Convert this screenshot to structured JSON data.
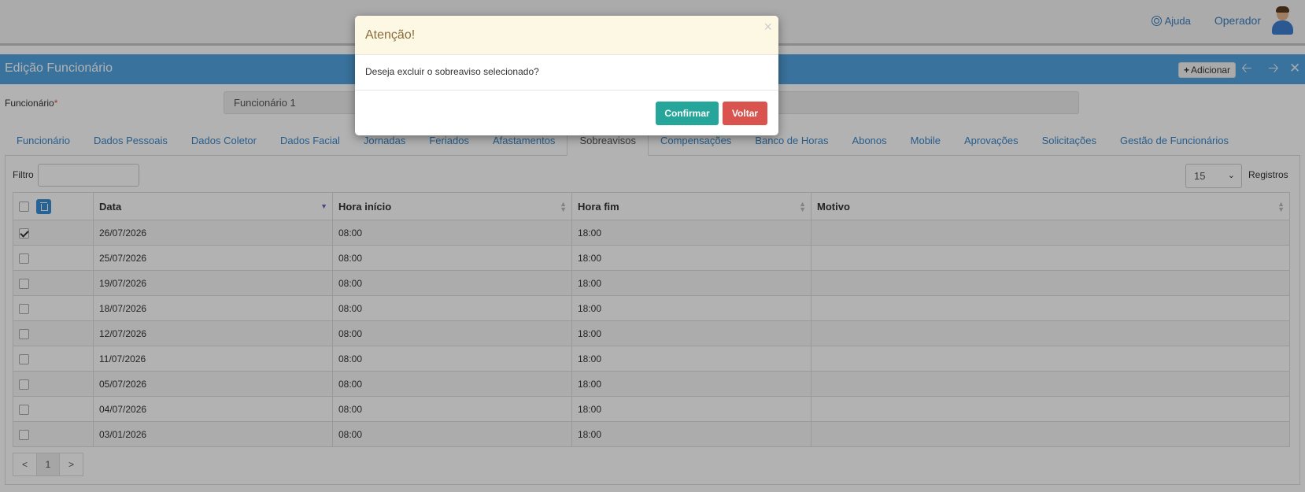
{
  "header": {
    "help_label": "Ajuda",
    "user_label": "Operador"
  },
  "titlebar": {
    "title": "Edição Funcionário",
    "add_label": "Adicionar"
  },
  "employee": {
    "label": "Funcionário",
    "required_mark": "*",
    "value": "Funcionário 1"
  },
  "tabs": [
    {
      "label": "Funcionário"
    },
    {
      "label": "Dados Pessoais"
    },
    {
      "label": "Dados Coletor"
    },
    {
      "label": "Dados Facial"
    },
    {
      "label": "Jornadas"
    },
    {
      "label": "Feriados"
    },
    {
      "label": "Afastamentos"
    },
    {
      "label": "Sobreavisos",
      "active": true
    },
    {
      "label": "Compensações"
    },
    {
      "label": "Banco de Horas"
    },
    {
      "label": "Abonos"
    },
    {
      "label": "Mobile"
    },
    {
      "label": "Aprovações"
    },
    {
      "label": "Solicitações"
    },
    {
      "label": "Gestão de Funcionários"
    }
  ],
  "filter": {
    "label": "Filtro",
    "value": ""
  },
  "page_size": {
    "value": "15",
    "records_label": "Registros"
  },
  "table": {
    "columns": [
      "Data",
      "Hora início",
      "Hora fim",
      "Motivo"
    ],
    "rows": [
      {
        "checked": true,
        "data": "26/07/2026",
        "inicio": "08:00",
        "fim": "18:00",
        "motivo": ""
      },
      {
        "checked": false,
        "data": "25/07/2026",
        "inicio": "08:00",
        "fim": "18:00",
        "motivo": ""
      },
      {
        "checked": false,
        "data": "19/07/2026",
        "inicio": "08:00",
        "fim": "18:00",
        "motivo": ""
      },
      {
        "checked": false,
        "data": "18/07/2026",
        "inicio": "08:00",
        "fim": "18:00",
        "motivo": ""
      },
      {
        "checked": false,
        "data": "12/07/2026",
        "inicio": "08:00",
        "fim": "18:00",
        "motivo": ""
      },
      {
        "checked": false,
        "data": "11/07/2026",
        "inicio": "08:00",
        "fim": "18:00",
        "motivo": ""
      },
      {
        "checked": false,
        "data": "05/07/2026",
        "inicio": "08:00",
        "fim": "18:00",
        "motivo": ""
      },
      {
        "checked": false,
        "data": "04/07/2026",
        "inicio": "08:00",
        "fim": "18:00",
        "motivo": ""
      },
      {
        "checked": false,
        "data": "03/01/2026",
        "inicio": "08:00",
        "fim": "18:00",
        "motivo": ""
      }
    ]
  },
  "pagination": {
    "prev": "<",
    "current": "1",
    "next": ">"
  },
  "modal": {
    "title": "Atenção!",
    "close": "×",
    "message": "Deseja excluir o sobreaviso selecionado?",
    "confirm_label": "Confirmar",
    "back_label": "Voltar"
  },
  "colors": {
    "titlebar": "#52a4e0",
    "confirm": "#26a69a",
    "back": "#d9534f",
    "modal_header": "#fcf8e3"
  }
}
